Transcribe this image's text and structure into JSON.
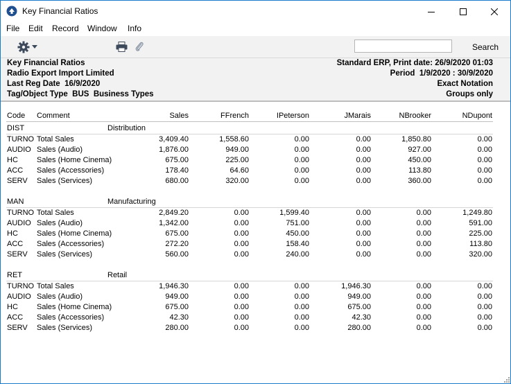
{
  "window": {
    "title": "Key Financial Ratios",
    "icon": "app-logo-icon",
    "controls": [
      "minimize-icon",
      "maximize-icon",
      "close-icon"
    ]
  },
  "menu": [
    "File",
    "Edit",
    "Record",
    "Window",
    "Info"
  ],
  "toolbar": {
    "search_label": "Search",
    "search_value": "",
    "icons": [
      "gear-icon",
      "print-icon",
      "paperclip-icon"
    ]
  },
  "header": {
    "left": [
      "Key Financial Ratios",
      "Radio Export Import Limited",
      "Last Reg Date  16/9/2020",
      "Tag/Object Type  BUS  Business Types"
    ],
    "right": [
      "Standard ERP, Print date: 26/9/2020 01:03",
      "Period  1/9/2020 : 30/9/2020",
      "Exact Notation",
      "Groups only"
    ]
  },
  "columns": {
    "code": "Code",
    "comment": "Comment",
    "sales": "Sales",
    "ffrench": "FFrench",
    "ipeterson": "IPeterson",
    "jmarais": "JMarais",
    "nbrooker": "NBrooker",
    "ndupont": "NDupont"
  },
  "groups": [
    {
      "code": "DIST",
      "name": "Distribution",
      "rows": [
        {
          "code": "TURNO",
          "comment": "Total Sales",
          "sales": "3,409.40",
          "ffrench": "1,558.60",
          "ipeterson": "0.00",
          "jmarais": "0.00",
          "nbrooker": "1,850.80",
          "ndupont": "0.00"
        },
        {
          "code": "AUDIO",
          "comment": "Sales (Audio)",
          "sales": "1,876.00",
          "ffrench": "949.00",
          "ipeterson": "0.00",
          "jmarais": "0.00",
          "nbrooker": "927.00",
          "ndupont": "0.00"
        },
        {
          "code": "HC",
          "comment": "Sales (Home Cinema)",
          "sales": "675.00",
          "ffrench": "225.00",
          "ipeterson": "0.00",
          "jmarais": "0.00",
          "nbrooker": "450.00",
          "ndupont": "0.00"
        },
        {
          "code": "ACC",
          "comment": "Sales (Accessories)",
          "sales": "178.40",
          "ffrench": "64.60",
          "ipeterson": "0.00",
          "jmarais": "0.00",
          "nbrooker": "113.80",
          "ndupont": "0.00"
        },
        {
          "code": "SERV",
          "comment": "Sales (Services)",
          "sales": "680.00",
          "ffrench": "320.00",
          "ipeterson": "0.00",
          "jmarais": "0.00",
          "nbrooker": "360.00",
          "ndupont": "0.00"
        }
      ]
    },
    {
      "code": "MAN",
      "name": "Manufacturing",
      "rows": [
        {
          "code": "TURNO",
          "comment": "Total Sales",
          "sales": "2,849.20",
          "ffrench": "0.00",
          "ipeterson": "1,599.40",
          "jmarais": "0.00",
          "nbrooker": "0.00",
          "ndupont": "1,249.80"
        },
        {
          "code": "AUDIO",
          "comment": "Sales (Audio)",
          "sales": "1,342.00",
          "ffrench": "0.00",
          "ipeterson": "751.00",
          "jmarais": "0.00",
          "nbrooker": "0.00",
          "ndupont": "591.00"
        },
        {
          "code": "HC",
          "comment": "Sales (Home Cinema)",
          "sales": "675.00",
          "ffrench": "0.00",
          "ipeterson": "450.00",
          "jmarais": "0.00",
          "nbrooker": "0.00",
          "ndupont": "225.00"
        },
        {
          "code": "ACC",
          "comment": "Sales (Accessories)",
          "sales": "272.20",
          "ffrench": "0.00",
          "ipeterson": "158.40",
          "jmarais": "0.00",
          "nbrooker": "0.00",
          "ndupont": "113.80"
        },
        {
          "code": "SERV",
          "comment": "Sales (Services)",
          "sales": "560.00",
          "ffrench": "0.00",
          "ipeterson": "240.00",
          "jmarais": "0.00",
          "nbrooker": "0.00",
          "ndupont": "320.00"
        }
      ]
    },
    {
      "code": "RET",
      "name": "Retail",
      "rows": [
        {
          "code": "TURNO",
          "comment": "Total Sales",
          "sales": "1,946.30",
          "ffrench": "0.00",
          "ipeterson": "0.00",
          "jmarais": "1,946.30",
          "nbrooker": "0.00",
          "ndupont": "0.00"
        },
        {
          "code": "AUDIO",
          "comment": "Sales (Audio)",
          "sales": "949.00",
          "ffrench": "0.00",
          "ipeterson": "0.00",
          "jmarais": "949.00",
          "nbrooker": "0.00",
          "ndupont": "0.00"
        },
        {
          "code": "HC",
          "comment": "Sales (Home Cinema)",
          "sales": "675.00",
          "ffrench": "0.00",
          "ipeterson": "0.00",
          "jmarais": "675.00",
          "nbrooker": "0.00",
          "ndupont": "0.00"
        },
        {
          "code": "ACC",
          "comment": "Sales (Accessories)",
          "sales": "42.30",
          "ffrench": "0.00",
          "ipeterson": "0.00",
          "jmarais": "42.30",
          "nbrooker": "0.00",
          "ndupont": "0.00"
        },
        {
          "code": "SERV",
          "comment": "Sales (Services)",
          "sales": "280.00",
          "ffrench": "0.00",
          "ipeterson": "0.00",
          "jmarais": "280.00",
          "nbrooker": "0.00",
          "ndupont": "0.00"
        }
      ]
    }
  ]
}
